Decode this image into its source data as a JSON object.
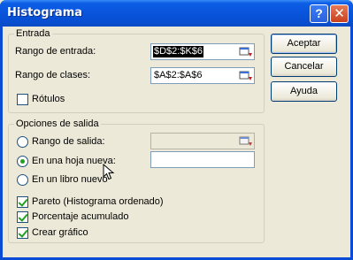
{
  "window": {
    "title": "Histograma"
  },
  "input_group": {
    "legend": "Entrada",
    "input_range_label": "Rango de entrada:",
    "input_range_value": "$D$2:$K$6",
    "bin_range_label": "Rango de clases:",
    "bin_range_value": "$A$2:$A$6",
    "labels_checkbox_label": "Rótulos",
    "labels_checked": false
  },
  "output_group": {
    "legend": "Opciones de salida",
    "output_range_label": "Rango de salida:",
    "output_range_value": "",
    "new_sheet_label": "En una hoja nueva:",
    "new_sheet_value": "",
    "new_workbook_label": "En un libro nuevo",
    "selected_option": "new_sheet",
    "pareto_label": "Pareto (Histograma ordenado)",
    "pareto_checked": true,
    "cumulative_label": "Porcentaje acumulado",
    "cumulative_checked": true,
    "chart_label": "Crear gráfico",
    "chart_checked": true
  },
  "buttons": {
    "ok": "Aceptar",
    "cancel": "Cancelar",
    "help": "Ayuda"
  }
}
